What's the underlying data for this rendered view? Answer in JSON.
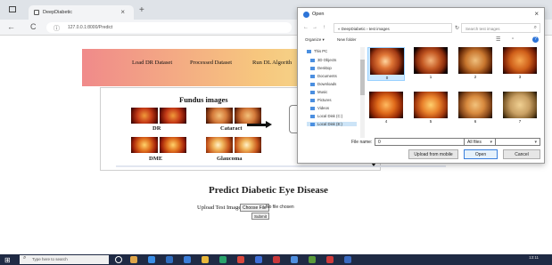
{
  "browser": {
    "tab_title": "DeepDiabetic",
    "tab_close": "×",
    "new_tab": "+",
    "url": "127.0.0.1:8000/Predict",
    "back": "←",
    "reload": "C"
  },
  "nav": {
    "load_dr": "Load DR Dataset",
    "processed": "Processed Dataset",
    "run_dl": "Run DL Algorith"
  },
  "figure": {
    "title": "Fundus images",
    "labels": {
      "dr": "DR",
      "cataract": "Cataract",
      "dme": "DME",
      "glaucoma": "Glaucoma"
    }
  },
  "predict": {
    "title": "Predict Diabetic Eye Disease",
    "upload_label": "Upload Test Image",
    "choose_file": "Choose File",
    "no_file": "No file chosen",
    "submit": "Submit"
  },
  "dialog": {
    "title": "Open",
    "close": "×",
    "path": "« DeepDiabetic › test images",
    "search_placeholder": "Search test images",
    "organize": "Organize ▾",
    "new_folder": "New folder",
    "sidebar": [
      {
        "label": "This PC"
      },
      {
        "label": "3D Objects"
      },
      {
        "label": "Desktop"
      },
      {
        "label": "Documents"
      },
      {
        "label": "Downloads"
      },
      {
        "label": "Music"
      },
      {
        "label": "Pictures"
      },
      {
        "label": "Videos"
      },
      {
        "label": "Local Disk (C:)"
      },
      {
        "label": "Local Disk (E:)"
      }
    ],
    "files": [
      {
        "name": "0",
        "selected": true
      },
      {
        "name": "1",
        "selected": false
      },
      {
        "name": "2",
        "selected": false
      },
      {
        "name": "3",
        "selected": false
      },
      {
        "name": "4",
        "selected": false
      },
      {
        "name": "5",
        "selected": false
      },
      {
        "name": "6",
        "selected": false
      },
      {
        "name": "7",
        "selected": false
      }
    ],
    "file_name_label": "File name:",
    "file_name_value": "0",
    "file_type": "All files",
    "upload_online": "Upload from mobile",
    "open": "Open",
    "cancel": "Cancel"
  },
  "taskbar": {
    "search_placeholder": "Type here to search",
    "time": "13:11",
    "date": "12-01-2022"
  }
}
